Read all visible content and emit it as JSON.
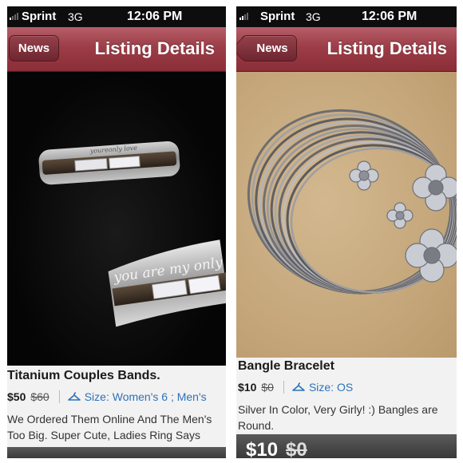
{
  "left": {
    "status": {
      "carrier": "Sprint",
      "network": "3G",
      "time": "12:06 PM"
    },
    "nav": {
      "back_label": "News",
      "title": "Listing Details"
    },
    "photo": {
      "ring_engraving_1": "youreonly love",
      "ring_engraving_2": "you are my only"
    },
    "listing": {
      "title": "Titanium Couples Bands.",
      "price": "$50",
      "original_price": "$60",
      "size_label": "Size: Women's 6 ; Men's",
      "description_line1": "We Ordered Them Online And The Men's",
      "description_line2": "Too Big. Super Cute, Ladies Ring Says"
    }
  },
  "right": {
    "status": {
      "carrier": "Sprint",
      "network": "3G",
      "time": "12:06 PM"
    },
    "nav": {
      "back_label": "News",
      "title": "Listing Details"
    },
    "listing": {
      "title": "Bangle Bracelet",
      "price": "$10",
      "original_price": "$0",
      "size_label": "Size: OS",
      "description_line1": "Silver In Color, Very Girly! :) Bangles are",
      "description_line2": "Round."
    },
    "bottom_bar": {
      "price": "$10",
      "original_price": "$0"
    }
  },
  "colors": {
    "nav_bar": "#9c3d47",
    "size_link": "#2d72b8"
  }
}
